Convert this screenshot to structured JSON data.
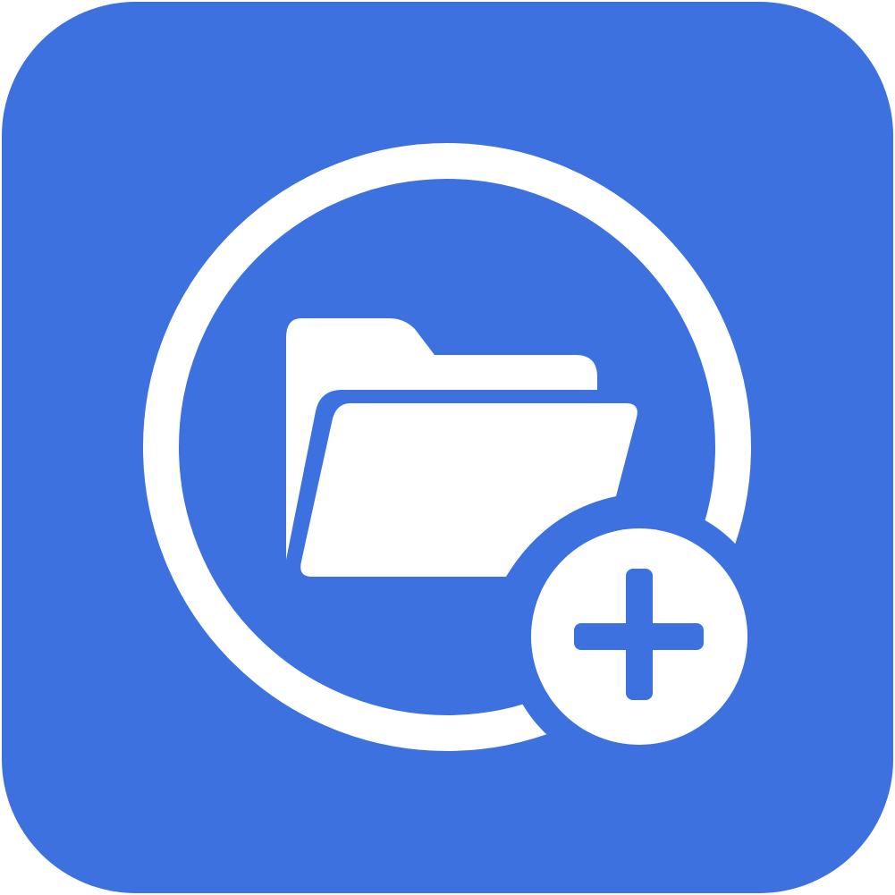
{
  "icon": {
    "name": "add-folder-icon",
    "glyphs": [
      "folder-icon",
      "plus-icon"
    ]
  },
  "colors": {
    "background": "#3d71df",
    "foreground": "#ffffff"
  }
}
